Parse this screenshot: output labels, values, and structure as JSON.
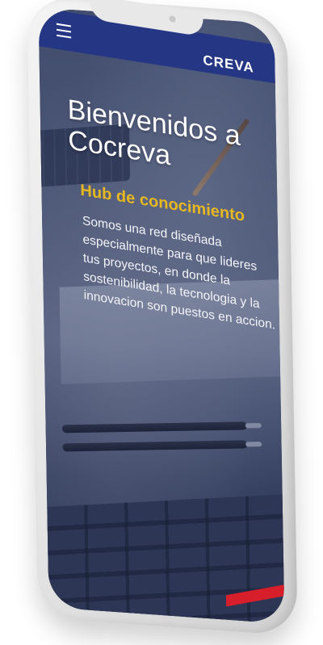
{
  "nav": {
    "brand": "CREVA",
    "menu_icon": "hamburger-menu-icon"
  },
  "hero": {
    "title_line1": "Bienvenidos a",
    "title_line2": "Cocreva",
    "subtitle": "Hub de conocimiento",
    "description": "Somos una red diseñada especialmente para que lideres tus proyectos, en donde la sostenibilidad, la tecnologia y la innovacion son puestos en accion."
  },
  "colors": {
    "nav_bg": "#253685",
    "subtitle": "#e8b81f",
    "accent_red": "#d61f2a"
  }
}
